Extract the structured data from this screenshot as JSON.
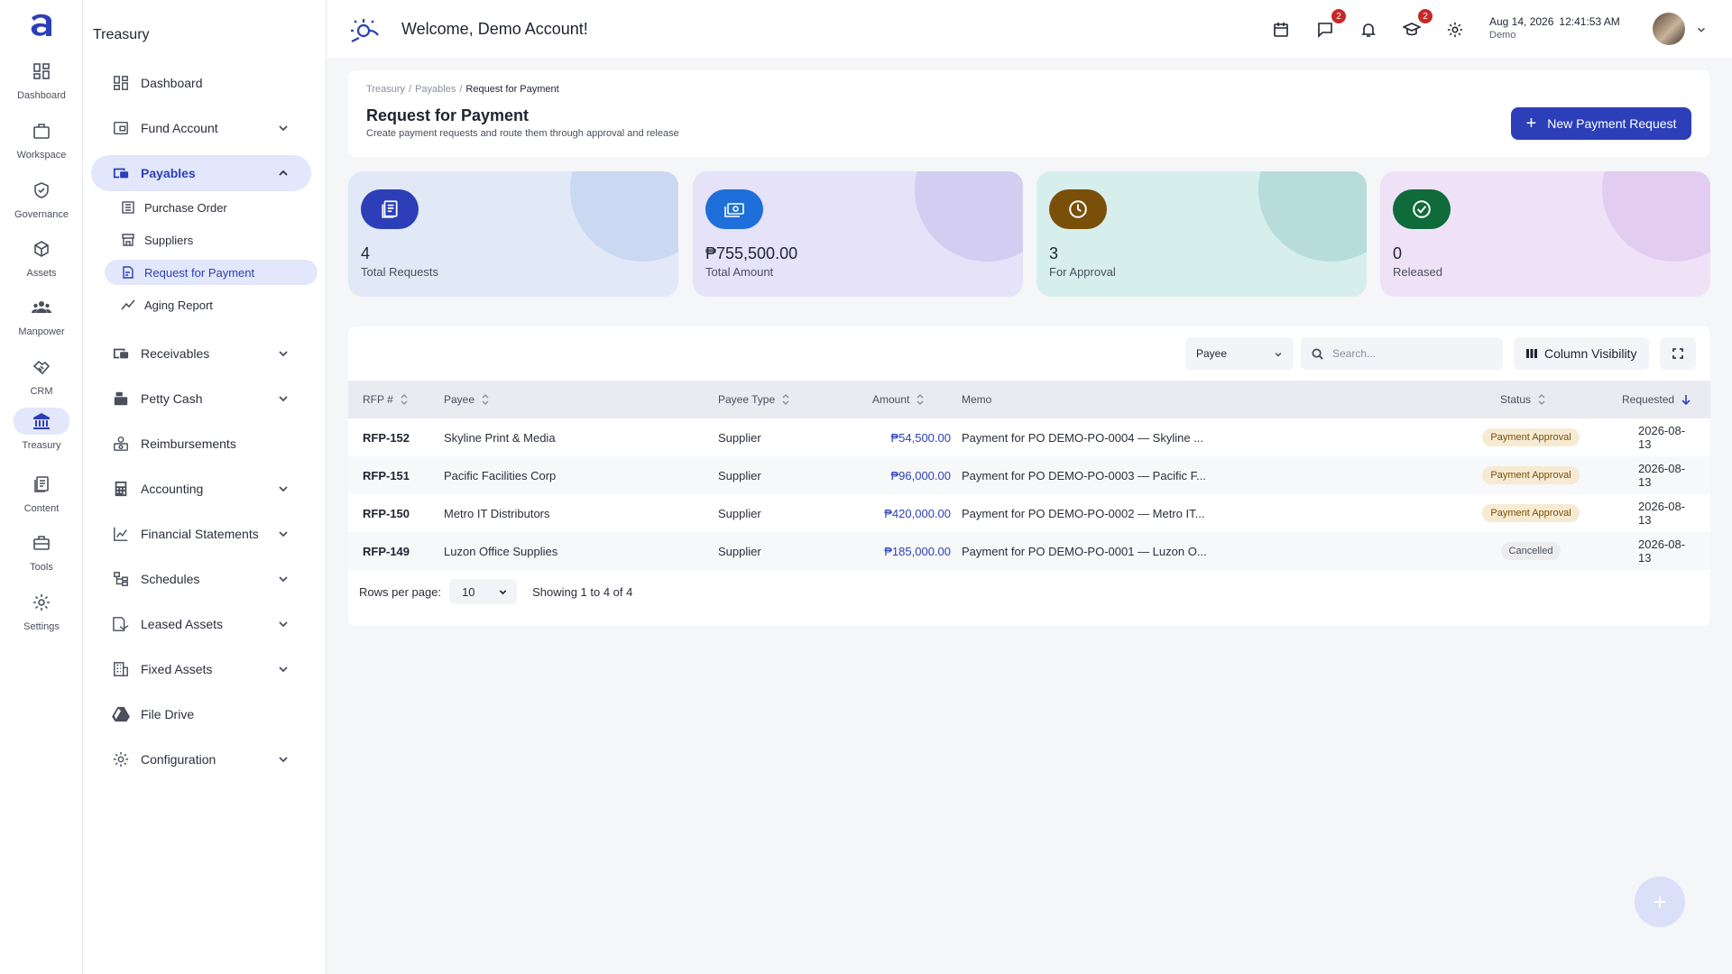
{
  "rail": {
    "items": [
      {
        "label": "Dashboard",
        "icon": "dashboard-icon"
      },
      {
        "label": "Workspace",
        "icon": "briefcase-icon"
      },
      {
        "label": "Governance",
        "icon": "shield-check-icon"
      },
      {
        "label": "Assets",
        "icon": "cube-icon"
      },
      {
        "label": "Manpower",
        "icon": "people-icon"
      },
      {
        "label": "CRM",
        "icon": "handshake-icon"
      },
      {
        "label": "Treasury",
        "icon": "bank-icon"
      },
      {
        "label": "Content",
        "icon": "document-icon"
      },
      {
        "label": "Tools",
        "icon": "toolbox-icon"
      },
      {
        "label": "Settings",
        "icon": "gear-icon"
      }
    ],
    "active": "Treasury"
  },
  "sidebar": {
    "title": "Treasury",
    "items": [
      {
        "label": "Dashboard"
      },
      {
        "label": "Fund Account"
      },
      {
        "label": "Payables"
      },
      {
        "label": "Receivables"
      },
      {
        "label": "Petty Cash"
      },
      {
        "label": "Reimbursements"
      },
      {
        "label": "Accounting"
      },
      {
        "label": "Financial Statements"
      },
      {
        "label": "Schedules"
      },
      {
        "label": "Leased Assets"
      },
      {
        "label": "Fixed Assets"
      },
      {
        "label": "File Drive"
      },
      {
        "label": "Configuration"
      }
    ],
    "payables_sub": [
      {
        "label": "Purchase Order"
      },
      {
        "label": "Suppliers"
      },
      {
        "label": "Request for Payment"
      },
      {
        "label": "Aging Report"
      }
    ]
  },
  "topbar": {
    "welcome": "Welcome, Demo Account!",
    "messages_badge": "2",
    "learning_badge": "2",
    "date": "Aug 14, 2026",
    "time": "12:41:53 AM",
    "user": "Demo"
  },
  "header": {
    "breadcrumb": [
      "Treasury",
      "Payables",
      "Request for Payment"
    ],
    "title": "Request for Payment",
    "subtitle": "Create payment requests and route them through approval and release",
    "new_button": "New Payment Request"
  },
  "stats": [
    {
      "value": "4",
      "label": "Total Requests",
      "bg": "#e1e9f7",
      "blob": "#cbd8f1",
      "icon_bg": "#2c3fb8",
      "icon": "document-icon"
    },
    {
      "value": "₱755,500.00",
      "label": "Total Amount",
      "bg": "#e6e2f7",
      "blob": "#d3cdf2",
      "icon_bg": "#1e6fd9",
      "icon": "cash-icon"
    },
    {
      "value": "3",
      "label": "For Approval",
      "bg": "#d6efec",
      "blob": "#b6ddd9",
      "icon_bg": "#7a4f0a",
      "icon": "clock-icon"
    },
    {
      "value": "0",
      "label": "Released",
      "bg": "#efe2f7",
      "blob": "#e2cdf0",
      "icon_bg": "#0f6b3a",
      "icon": "check-circle-icon"
    }
  ],
  "table": {
    "filter_select": "Payee",
    "search_placeholder": "Search...",
    "column_visibility": "Column Visibility",
    "columns": [
      "RFP #",
      "Payee",
      "Payee Type",
      "Amount",
      "Memo",
      "Status",
      "Requested"
    ],
    "rows": [
      {
        "rfp": "RFP-152",
        "payee": "Skyline Print & Media",
        "type": "Supplier",
        "amount": "₱54,500.00",
        "memo": "Payment for PO DEMO-PO-0004 — Skyline ...",
        "status": "Payment Approval",
        "status_kind": "approval",
        "requested": "2026-08-13"
      },
      {
        "rfp": "RFP-151",
        "payee": "Pacific Facilities Corp",
        "type": "Supplier",
        "amount": "₱96,000.00",
        "memo": "Payment for PO DEMO-PO-0003 — Pacific F...",
        "status": "Payment Approval",
        "status_kind": "approval",
        "requested": "2026-08-13"
      },
      {
        "rfp": "RFP-150",
        "payee": "Metro IT Distributors",
        "type": "Supplier",
        "amount": "₱420,000.00",
        "memo": "Payment for PO DEMO-PO-0002 — Metro IT...",
        "status": "Payment Approval",
        "status_kind": "approval",
        "requested": "2026-08-13"
      },
      {
        "rfp": "RFP-149",
        "payee": "Luzon Office Supplies",
        "type": "Supplier",
        "amount": "₱185,000.00",
        "memo": "Payment for PO DEMO-PO-0001 — Luzon O...",
        "status": "Cancelled",
        "status_kind": "cancelled",
        "requested": "2026-08-13"
      }
    ],
    "rows_per_page_label": "Rows per page:",
    "rows_per_page": "10",
    "showing": "Showing 1 to 4 of 4"
  },
  "fab_label": "+"
}
